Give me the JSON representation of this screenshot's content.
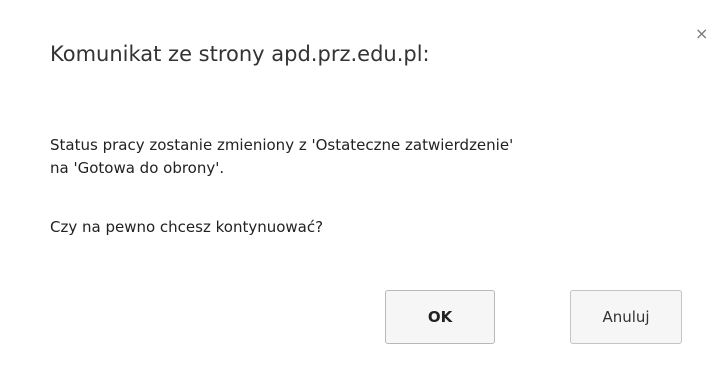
{
  "dialog": {
    "title": "Komunikat ze strony apd.prz.edu.pl:",
    "close_symbol": "×",
    "message_line1": "Status pracy zostanie zmieniony z 'Ostateczne zatwierdzenie'",
    "message_line2": "na 'Gotowa do obrony'.",
    "question": "Czy na pewno chcesz kontynuować?",
    "ok_label": "OK",
    "cancel_label": "Anuluj"
  }
}
